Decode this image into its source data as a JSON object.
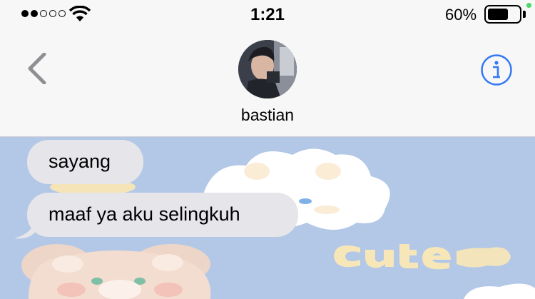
{
  "status_bar": {
    "signal": "signal-dots-icon",
    "wifi": "wifi-icon",
    "time": "1:21",
    "battery_percent": "60%",
    "battery": "battery-icon",
    "battery_level": 0.6
  },
  "nav": {
    "back": "chevron-left-icon",
    "contact_name": "bastian",
    "avatar": "contact-avatar",
    "info": "info-icon",
    "accent_color": "#3478f6"
  },
  "messages": [
    {
      "text": "sayang",
      "direction": "incoming"
    },
    {
      "text": "maaf ya aku selingkuh",
      "direction": "incoming"
    }
  ],
  "wallpaper": {
    "sticker_text": "Cute",
    "background_color": "#b3c8e6"
  }
}
